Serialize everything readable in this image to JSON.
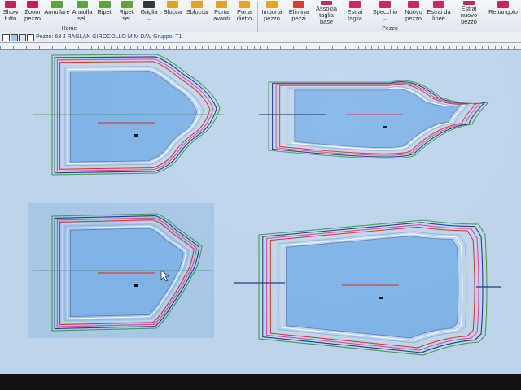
{
  "ribbon": {
    "home_buttons": [
      {
        "label": "Show\ntutto",
        "icon": "show-all-icon",
        "color": "#c71f5b"
      },
      {
        "label": "Zoom\npezzo",
        "icon": "zoom-piece-icon",
        "color": "#c71f5b"
      },
      {
        "label": "Annullare",
        "icon": "undo-icon",
        "color": "#5ba33a"
      },
      {
        "label": "Annulla\nsel.",
        "icon": "undo-selection-icon",
        "color": "#5ba33a"
      },
      {
        "label": "Ripeti",
        "icon": "redo-icon",
        "color": "#5ba33a"
      },
      {
        "label": "Ripeti\nsel.",
        "icon": "redo-selection-icon",
        "color": "#5ba33a"
      },
      {
        "label": "Griglia\n⌄",
        "icon": "grid-icon",
        "color": "#333333"
      },
      {
        "label": "Blocca",
        "icon": "lock-icon",
        "color": "#e0a21a"
      },
      {
        "label": "Sblocca",
        "icon": "unlock-icon",
        "color": "#e0a21a"
      },
      {
        "label": "Porta\navanti",
        "icon": "bring-forward-icon",
        "color": "#e0a21a"
      },
      {
        "label": "Porta\ndietro",
        "icon": "send-backward-icon",
        "color": "#e0a21a"
      }
    ],
    "pezzo_buttons": [
      {
        "label": "Importa\npezzo",
        "icon": "import-piece-icon",
        "color": "#e0a21a"
      },
      {
        "label": "Elimina\npezzi",
        "icon": "delete-pieces-icon",
        "color": "#d8322a"
      },
      {
        "label": "Associa\ntaglia base",
        "icon": "associate-base-size-icon",
        "color": "#c71f5b"
      },
      {
        "label": "Estrai\ntaglia",
        "icon": "extract-size-icon",
        "color": "#c71f5b"
      },
      {
        "label": "Specchio\n⌄",
        "icon": "mirror-icon",
        "color": "#c71f5b"
      },
      {
        "label": "Nuovo\npezzo",
        "icon": "new-piece-icon",
        "color": "#c71f5b"
      },
      {
        "label": "Estrai da\nlinee",
        "icon": "extract-from-lines-icon",
        "color": "#c71f5b"
      },
      {
        "label": "Estrai nuovo\npezzo",
        "icon": "extract-new-piece-icon",
        "color": "#c71f5b"
      },
      {
        "label": "Rettangolo",
        "icon": "rectangle-icon",
        "color": "#c71f5b"
      }
    ],
    "group_home": "Home",
    "group_pezzo": "Pezzo"
  },
  "infobar": {
    "piece_info": "Pezzo: 63 J RAGLAN  GIROCOLLO M M  DAV    Gruppo: T1"
  },
  "colors": {
    "canvas_bg": "#bcd3ea",
    "piece_fill": "#7fb2e6",
    "pink": "#e0429a",
    "red": "#d7301f",
    "green": "#3f9e4a",
    "navy": "#1f3a8c"
  }
}
